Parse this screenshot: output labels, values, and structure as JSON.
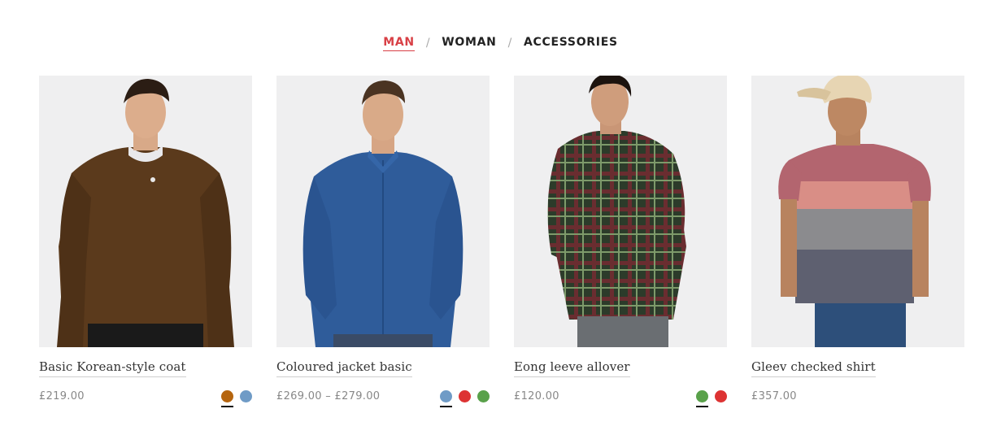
{
  "tabs": [
    {
      "label": "MAN",
      "active": true
    },
    {
      "label": "WOMAN",
      "active": false
    },
    {
      "label": "ACCESSORIES",
      "active": false
    }
  ],
  "tab_separator": "/",
  "products": [
    {
      "title": "Basic Korean-style coat",
      "price": "£219.00",
      "image": "man-brown-sweater",
      "swatches": [
        {
          "color": "#b5650f",
          "selected": true
        },
        {
          "color": "#6f9bc6",
          "selected": false
        }
      ]
    },
    {
      "title": "Coloured jacket basic",
      "price": "£269.00 – £279.00",
      "image": "man-blue-shirt",
      "swatches": [
        {
          "color": "#6f9bc6",
          "selected": true
        },
        {
          "color": "#dd3333",
          "selected": false
        },
        {
          "color": "#59a14a",
          "selected": false
        }
      ]
    },
    {
      "title": "Eong leeve allover",
      "price": "£120.00",
      "image": "man-plaid-shirt",
      "swatches": [
        {
          "color": "#59a14a",
          "selected": true
        },
        {
          "color": "#dd3333",
          "selected": false
        }
      ]
    },
    {
      "title": "Gleev checked shirt",
      "price": "£357.00",
      "image": "man-striped-polo",
      "swatches": []
    }
  ]
}
